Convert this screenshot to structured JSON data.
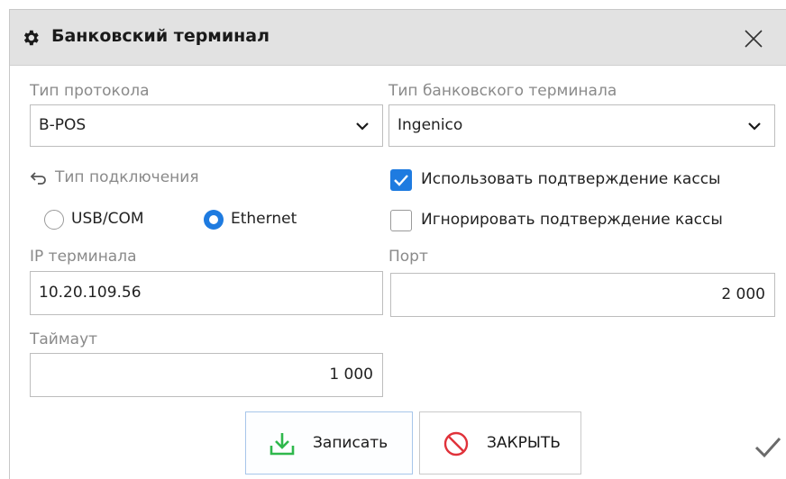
{
  "window": {
    "title": "Банковский терминал"
  },
  "protocol": {
    "label": "Тип протокола",
    "value": "B-POS"
  },
  "terminal_type": {
    "label": "Тип банковского терминала",
    "value": "Ingenico"
  },
  "connection": {
    "label": "Тип подключения",
    "options": [
      {
        "label": "USB/COM",
        "selected": false
      },
      {
        "label": "Ethernet",
        "selected": true
      }
    ]
  },
  "confirmations": [
    {
      "label": "Использовать подтверждение кассы",
      "checked": true
    },
    {
      "label": "Игнорировать подтверждение кассы",
      "checked": false
    }
  ],
  "ip": {
    "label": "IP терминала",
    "value": "10.20.109.56"
  },
  "port": {
    "label": "Порт",
    "value": "2 000"
  },
  "timeout": {
    "label": "Таймаут",
    "value": "1 000"
  },
  "buttons": {
    "save": "Записать",
    "close": "ЗАКРЫТЬ"
  },
  "icons": {
    "title": "gear-icon",
    "close": "close-icon",
    "connection": "undo-arrow-icon",
    "save": "download-icon",
    "cancel": "prohibited-icon",
    "corner": "checkmark-icon"
  },
  "colors": {
    "accent": "#1e7be0",
    "save_icon": "#2fb84c",
    "cancel_icon": "#e0323a",
    "titlebar": "#e2e2e2"
  }
}
